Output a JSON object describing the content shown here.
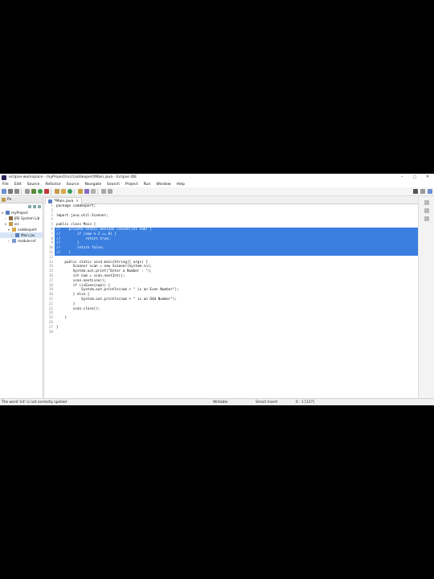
{
  "window": {
    "title": "eclipse-workspace - myProject/src/caddexpert/Main.java - Eclipse IDE",
    "controls": [
      "–",
      "▢",
      "✕"
    ]
  },
  "menu": [
    "File",
    "Edit",
    "Source",
    "Refactor",
    "Source",
    "Navigate",
    "Search",
    "Project",
    "Run",
    "Window",
    "Help"
  ],
  "toolbar": {
    "left_icons": [
      "new-icon",
      "save-icon",
      "save-all-icon",
      "print-icon",
      "debug-icon",
      "run-icon",
      "coverage-icon",
      "new-java-project-icon",
      "new-package-icon",
      "new-class-icon",
      "open-type-icon",
      "search-icon",
      "annotation-icon",
      "back-icon",
      "forward-icon"
    ],
    "right_icons": [
      "search-icon",
      "open-perspective-icon",
      "java-perspective-icon"
    ]
  },
  "sidebar": {
    "tab_label": "Pa",
    "tree": [
      {
        "label": "myProject",
        "indent": 1,
        "arrow": "▾",
        "selected": false
      },
      {
        "label": "JRE System Lib",
        "indent": 2,
        "arrow": "›",
        "selected": false
      },
      {
        "label": "src",
        "indent": 2,
        "arrow": "▾",
        "selected": false
      },
      {
        "label": "caddexpert",
        "indent": 3,
        "arrow": "▾",
        "selected": false
      },
      {
        "label": "Main.jav",
        "indent": 4,
        "arrow": "›",
        "selected": true
      },
      {
        "label": "module-inf",
        "indent": 3,
        "arrow": "›",
        "selected": false
      }
    ]
  },
  "editor": {
    "tab_label": "*Main.java",
    "tab_close": "✕",
    "lines": [
      {
        "n": "1",
        "text": "package caddexpert;",
        "sel": false
      },
      {
        "n": "2",
        "text": "",
        "sel": false
      },
      {
        "n": "3",
        "text": "import java.util.Scanner;",
        "sel": false
      },
      {
        "n": "4",
        "text": "",
        "sel": false
      },
      {
        "n": "5",
        "text": "public class Main {",
        "sel": false
      },
      {
        "n": "6",
        "text": "//    private static boolean isEven(int num) {",
        "sel": true
      },
      {
        "n": "7",
        "text": "//        if (num % 2 == 0) {",
        "sel": true
      },
      {
        "n": "8",
        "text": "//            return true;",
        "sel": true
      },
      {
        "n": "9",
        "text": "//        }",
        "sel": true
      },
      {
        "n": "10",
        "text": "//        return false;",
        "sel": true
      },
      {
        "n": "11",
        "text": "//    }",
        "sel": true
      },
      {
        "n": "12",
        "text": "",
        "sel": false
      },
      {
        "n": "13",
        "text": "    public static void main(String[] args) {",
        "sel": false
      },
      {
        "n": "14",
        "text": "        Scanner scan = new Scanner(System.in);",
        "sel": false
      },
      {
        "n": "15",
        "text": "        System.out.print(\"Enter a Number : \");",
        "sel": false
      },
      {
        "n": "16",
        "text": "        int num = scan.nextInt();",
        "sel": false
      },
      {
        "n": "17",
        "text": "        scan.nextLine();",
        "sel": false
      },
      {
        "n": "18",
        "text": "        if (isEven(num)) {",
        "sel": false
      },
      {
        "n": "19",
        "text": "            System.out.println(num + \" is an Even Number\");",
        "sel": false
      },
      {
        "n": "20",
        "text": "        } else {",
        "sel": false
      },
      {
        "n": "21",
        "text": "            System.out.println(num + \" is an Odd Number\");",
        "sel": false
      },
      {
        "n": "22",
        "text": "        }",
        "sel": false
      },
      {
        "n": "23",
        "text": "        scan.close();",
        "sel": false
      },
      {
        "n": "24",
        "text": "",
        "sel": false
      },
      {
        "n": "25",
        "text": "    }",
        "sel": false
      },
      {
        "n": "26",
        "text": "",
        "sel": false
      },
      {
        "n": "27",
        "text": "}",
        "sel": false
      },
      {
        "n": "28",
        "text": "",
        "sel": false
      }
    ]
  },
  "status": {
    "message": "The word 'int' is not correctly spelled",
    "mode": "Writable",
    "insert": "Smart Insert",
    "position": "6 : 1 [127]"
  },
  "colors": {
    "selection": "#3a7fe0",
    "background": "#000000"
  }
}
